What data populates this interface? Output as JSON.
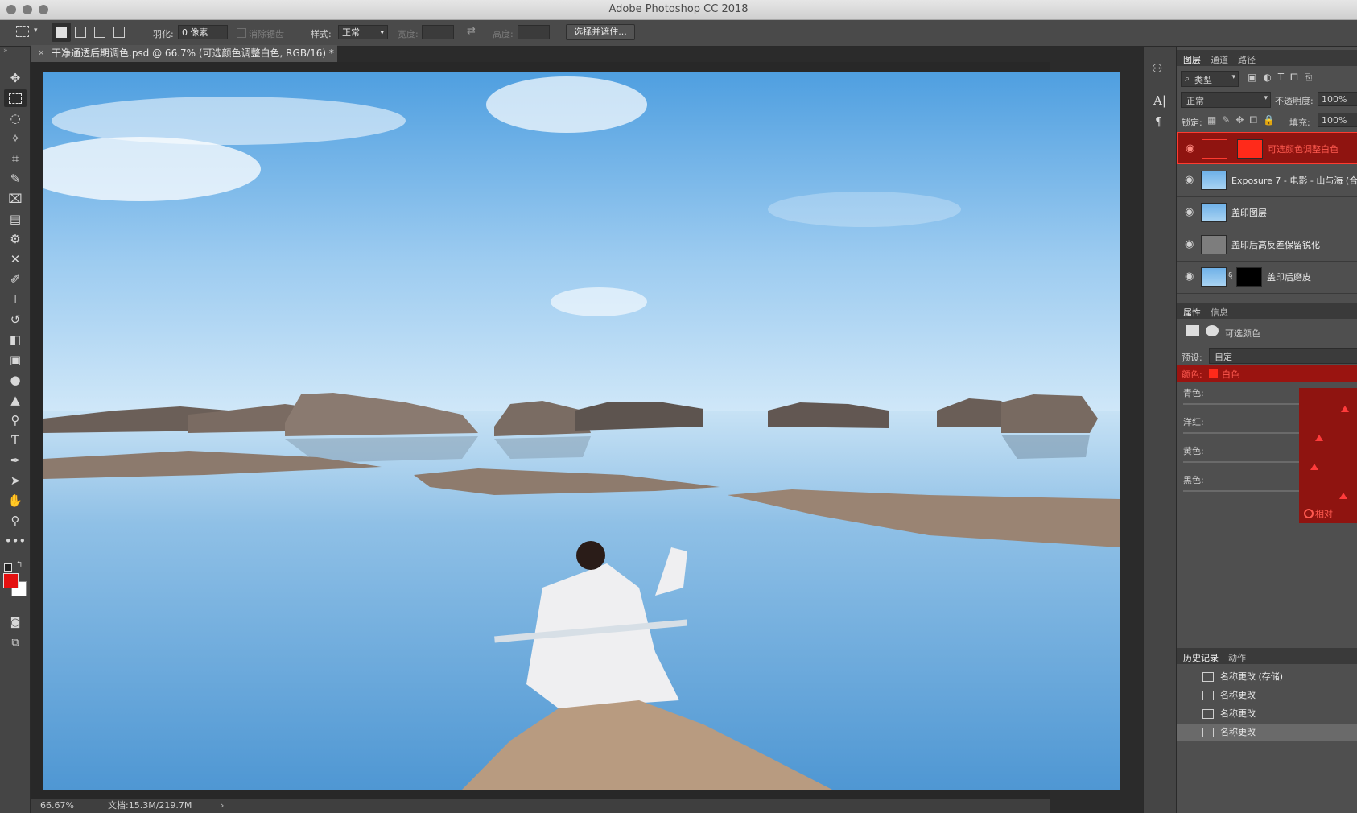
{
  "window": {
    "title": "Adobe Photoshop CC 2018"
  },
  "options": {
    "feather_label": "羽化:",
    "feather_value": "0 像素",
    "antialias_label": "消除锯齿",
    "style_label": "样式:",
    "style_value": "正常",
    "width_label": "宽度:",
    "height_label": "高度:",
    "select_mask_button": "选择并遮住..."
  },
  "document": {
    "tab_title": "干净通透后期调色.psd @ 66.7% (可选颜色调整白色, RGB/16) *",
    "zoom": "66.67%",
    "doc_size": "文档:15.3M/219.7M"
  },
  "layers_panel": {
    "tabs": [
      "图层",
      "通道",
      "路径"
    ],
    "filter_label": "类型",
    "blend_mode": "正常",
    "opacity_label": "不透明度:",
    "opacity_value": "100%",
    "lock_label": "锁定:",
    "fill_label": "填充:",
    "fill_value": "100%",
    "layers": [
      {
        "name": "可选颜色调整白色",
        "selected": true
      },
      {
        "name": "Exposure 7 - 电影 - 山与海 (合",
        "selected": false
      },
      {
        "name": "盖印图层",
        "selected": false
      },
      {
        "name": "盖印后高反差保留锐化",
        "selected": false
      },
      {
        "name": "盖印后磨皮",
        "selected": false
      }
    ]
  },
  "properties_panel": {
    "tabs": [
      "属性",
      "信息"
    ],
    "title": "可选颜色",
    "preset_label": "预设:",
    "preset_value": "自定",
    "color_label": "颜色:",
    "color_value": "白色",
    "sliders": [
      "青色:",
      "洋红:",
      "黄色:",
      "黑色:"
    ],
    "relative_label": "相对"
  },
  "history_panel": {
    "tabs": [
      "历史记录",
      "动作"
    ],
    "items": [
      "名称更改 (存储)",
      "名称更改",
      "名称更改",
      "名称更改"
    ]
  },
  "colors": {
    "foreground": "#e41010",
    "background": "#ffffff",
    "accent_red": "#b11a14"
  }
}
